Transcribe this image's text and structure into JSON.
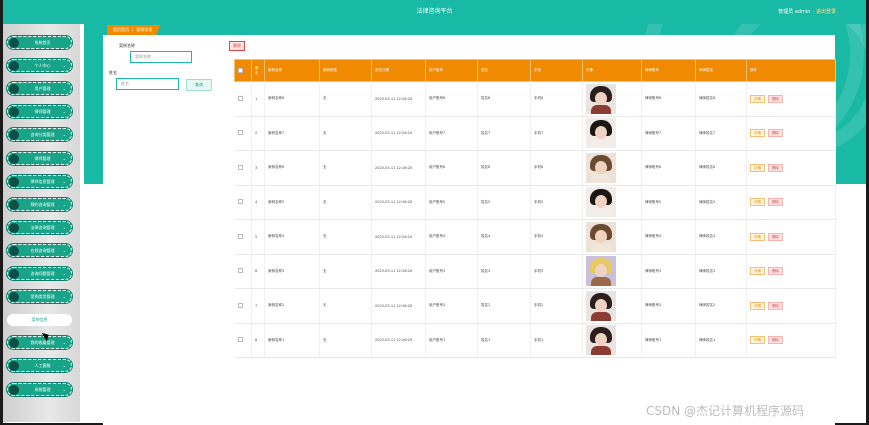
{
  "header": {
    "title": "法律咨询平台",
    "user_label": "管理员 admin",
    "logout": "退出登录"
  },
  "colors": {
    "primary": "#18b9a5",
    "accent": "#f08a00",
    "danger": "#e04848"
  },
  "sidebar": {
    "items": [
      {
        "label": "系统首页",
        "chevron": false
      },
      {
        "label": "个人中心",
        "chevron": true
      },
      {
        "label": "用户管理",
        "chevron": true
      },
      {
        "label": "律师管理",
        "chevron": true
      },
      {
        "label": "咨询分类管理",
        "chevron": true
      },
      {
        "label": "律师管理",
        "chevron": true
      },
      {
        "label": "律师信息管理",
        "chevron": true
      },
      {
        "label": "预约咨询管理",
        "chevron": true
      },
      {
        "label": "法律咨询管理",
        "chevron": true
      },
      {
        "label": "在线咨询管理",
        "chevron": true
      },
      {
        "label": "咨询问题管理",
        "chevron": true
      },
      {
        "label": "案例类型管理",
        "chevron": true
      }
    ],
    "sub_item": {
      "label": "案例信息"
    },
    "items_after": [
      {
        "label": "我的收藏管理",
        "chevron": true
      },
      {
        "label": "人工客服",
        "chevron": true
      },
      {
        "label": "系统管理",
        "chevron": true
      }
    ]
  },
  "breadcrumb": {
    "home": "首页首页",
    "separator": "/",
    "current": "案例信息"
  },
  "filters": {
    "case_name_label": "案例名称",
    "case_name_placeholder": "案例名称",
    "name_label": "姓名",
    "name_placeholder": "姓名",
    "search_button": "查询"
  },
  "toolbar": {
    "delete_label": "删除"
  },
  "table": {
    "columns": [
      "",
      "索引",
      "案例名称",
      "案例类型",
      "发布日期",
      "用户账号",
      "姓名",
      "手机",
      "头像",
      "律师账号",
      "律师姓名",
      "操作"
    ],
    "rows": [
      {
        "index": "1",
        "case_name": "案例名称8",
        "case_type": "无",
        "date": "2023-03-11 12:26:20",
        "user": "用户账号8",
        "name": "姓名8",
        "phone": "手机8",
        "lawyer_account": "律师账号8",
        "lawyer_name": "律师姓名8",
        "avatar": "boy-dark"
      },
      {
        "index": "2",
        "case_name": "案例名称7",
        "case_type": "无",
        "date": "2023-03-11 12:26:20",
        "user": "用户账号7",
        "name": "姓名7",
        "phone": "手机7",
        "lawyer_account": "律师账号7",
        "lawyer_name": "律师姓名7",
        "avatar": "girl-dark"
      },
      {
        "index": "3",
        "case_name": "案例名称6",
        "case_type": "无",
        "date": "2023-03-11 12:26:20",
        "user": "用户账号6",
        "name": "姓名6",
        "phone": "手机6",
        "lawyer_account": "律师账号6",
        "lawyer_name": "律师姓名6",
        "avatar": "girl-brown"
      },
      {
        "index": "4",
        "case_name": "案例名称5",
        "case_type": "无",
        "date": "2023-03-11 12:26:20",
        "user": "用户账号5",
        "name": "姓名5",
        "phone": "手机5",
        "lawyer_account": "律师账号5",
        "lawyer_name": "律师姓名5",
        "avatar": "girl-dark"
      },
      {
        "index": "5",
        "case_name": "案例名称4",
        "case_type": "无",
        "date": "2023-03-11 12:26:20",
        "user": "用户账号4",
        "name": "姓名4",
        "phone": "手机4",
        "lawyer_account": "律师账号4",
        "lawyer_name": "律师姓名4",
        "avatar": "girl-brown"
      },
      {
        "index": "6",
        "case_name": "案例名称3",
        "case_type": "无",
        "date": "2023-03-11 12:26:20",
        "user": "用户账号3",
        "name": "姓名3",
        "phone": "手机3",
        "lawyer_account": "律师账号3",
        "lawyer_name": "律师姓名3",
        "avatar": "boy-blond"
      },
      {
        "index": "7",
        "case_name": "案例名称2",
        "case_type": "无",
        "date": "2023-03-11 12:26:20",
        "user": "用户账号2",
        "name": "姓名2",
        "phone": "手机2",
        "lawyer_account": "律师账号2",
        "lawyer_name": "律师姓名2",
        "avatar": "boy-dark"
      },
      {
        "index": "8",
        "case_name": "案例名称1",
        "case_type": "无",
        "date": "2023-03-11 12:26:20",
        "user": "用户账号1",
        "name": "姓名1",
        "phone": "手机1",
        "lawyer_account": "律师账号1",
        "lawyer_name": "律师姓名1",
        "avatar": "boy-dark"
      }
    ],
    "detail_label": "详情",
    "row_delete_label": "删除"
  },
  "watermark": "CSDN @杰记计算机程序源码"
}
